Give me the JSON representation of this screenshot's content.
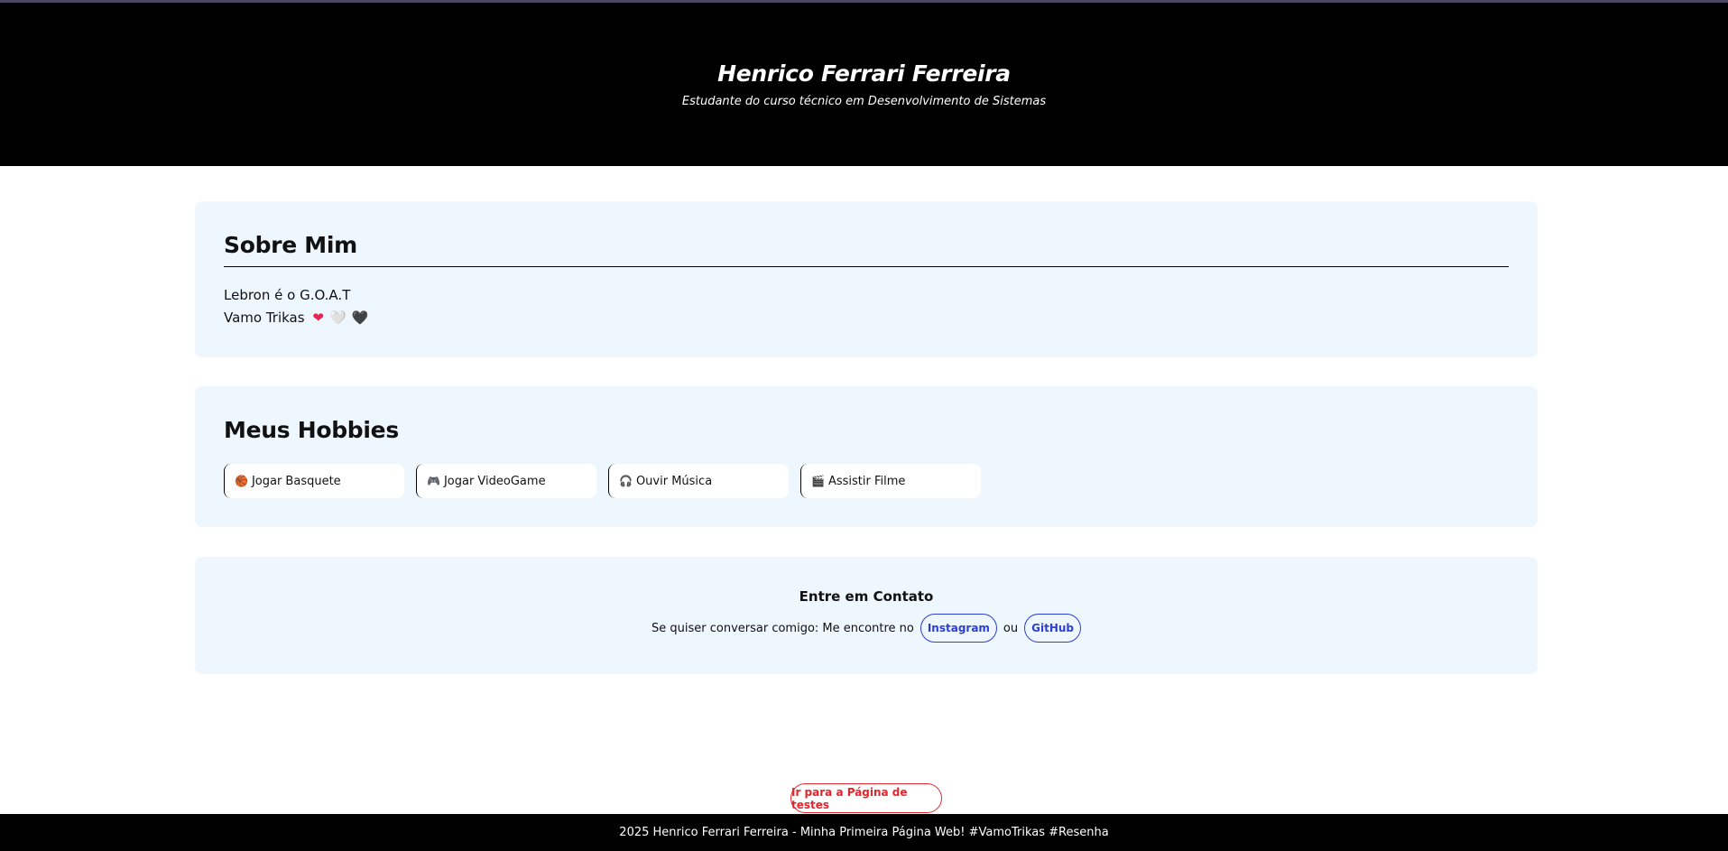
{
  "header": {
    "title": "Henrico Ferrari Ferreira",
    "subtitle": "Estudante do curso técnico em Desenvolvimento de Sistemas"
  },
  "about": {
    "heading": "Sobre Mim",
    "line1": "Lebron é o G.O.A.T",
    "line2": "Vamo Trikas",
    "hearts": [
      "❤",
      "🤍",
      "🖤"
    ]
  },
  "hobbies": {
    "heading": "Meus Hobbies",
    "items": [
      {
        "icon": "🏀",
        "label": "Jogar Basquete"
      },
      {
        "icon": "🎮",
        "label": "Jogar VideoGame"
      },
      {
        "icon": "🎧",
        "label": "Ouvir Música"
      },
      {
        "icon": "🎬",
        "label": "Assistir Filme"
      }
    ]
  },
  "contact": {
    "heading": "Entre em Contato",
    "text": "Se quiser conversar comigo: Me encontre no",
    "instagram": "Instagram",
    "separator": "ou",
    "github": "GitHub"
  },
  "test_button": "Ir para a Página de testes",
  "footer": "2025 Henrico Ferrari Ferreira - Minha Primeira Página Web! #VamoTrikas #Resenha",
  "colors": {
    "header_bg": "#000000",
    "card_bg": "#eef6fe",
    "link_blue": "#2b3fd6",
    "test_red": "#e0262c"
  }
}
